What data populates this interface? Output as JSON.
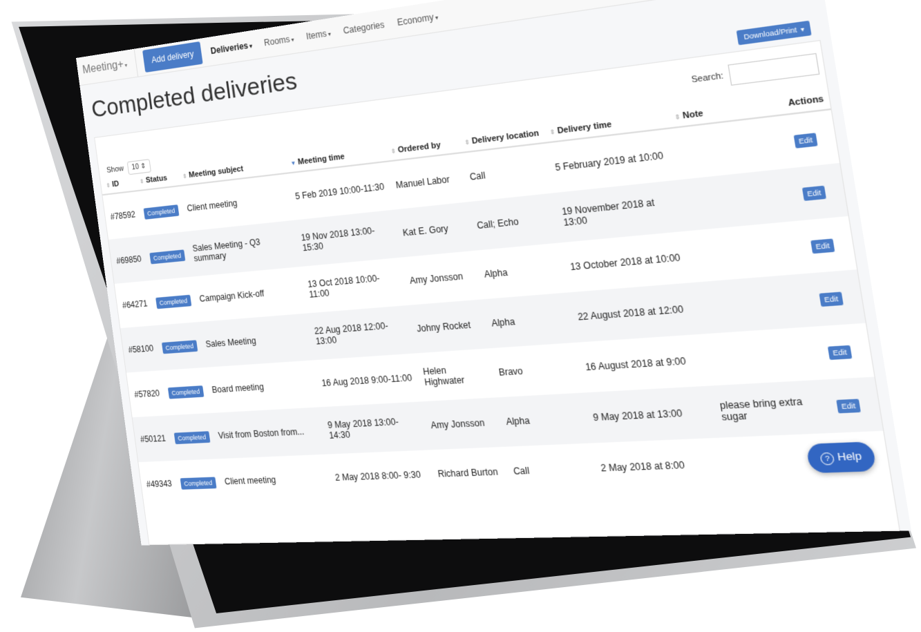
{
  "nav": {
    "brand": "Meeting+",
    "add_button": "Add delivery",
    "items": [
      "Deliveries",
      "Rooms",
      "Items",
      "Categories",
      "Economy"
    ]
  },
  "page": {
    "title": "Completed deliveries",
    "download_button": "Download/Print",
    "show_label": "Show",
    "show_value": "10",
    "search_label": "Search:"
  },
  "table": {
    "headers": [
      "ID",
      "Status",
      "Meeting subject",
      "Meeting time",
      "Ordered by",
      "Delivery location",
      "Delivery time",
      "Note",
      "Actions"
    ],
    "rows": [
      {
        "id": "#78592",
        "status": "Completed",
        "subject": "Client meeting",
        "time": "5 Feb 2019 10:00-11:30",
        "by": "Manuel Labor",
        "location": "Call",
        "dtime": "5 February 2019 at 10:00",
        "note": "",
        "action": "Edit"
      },
      {
        "id": "#69850",
        "status": "Completed",
        "subject": "Sales Meeting - Q3 summary",
        "time": "19 Nov 2018 13:00-15:30",
        "by": "Kat E. Gory",
        "location": "Call; Echo",
        "dtime": "19 November 2018 at 13:00",
        "note": "",
        "action": "Edit"
      },
      {
        "id": "#64271",
        "status": "Completed",
        "subject": "Campaign Kick-off",
        "time": "13 Oct 2018 10:00-11:00",
        "by": "Amy Jonsson",
        "location": "Alpha",
        "dtime": "13 October 2018 at 10:00",
        "note": "",
        "action": "Edit"
      },
      {
        "id": "#58100",
        "status": "Completed",
        "subject": "Sales Meeting",
        "time": "22 Aug 2018 12:00-13:00",
        "by": "Johny Rocket",
        "location": "Alpha",
        "dtime": "22 August 2018 at 12:00",
        "note": "",
        "action": "Edit"
      },
      {
        "id": "#57820",
        "status": "Completed",
        "subject": "Board meeting",
        "time": "16 Aug 2018  9:00-11:00",
        "by": "Helen Highwater",
        "location": "Bravo",
        "dtime": "16 August 2018 at  9:00",
        "note": "",
        "action": "Edit"
      },
      {
        "id": "#50121",
        "status": "Completed",
        "subject": "Visit from Boston from...",
        "time": "9 May 2018 13:00-14:30",
        "by": "Amy Jonsson",
        "location": "Alpha",
        "dtime": "9 May 2018 at 13:00",
        "note": "please bring extra sugar",
        "action": "Edit"
      },
      {
        "id": "#49343",
        "status": "Completed",
        "subject": "Client meeting",
        "time": "2 May 2018  8:00- 9:30",
        "by": "Richard Burton",
        "location": "Call",
        "dtime": "2 May 2018 at  8:00",
        "note": "",
        "action": ""
      }
    ]
  },
  "help_button": "Help"
}
